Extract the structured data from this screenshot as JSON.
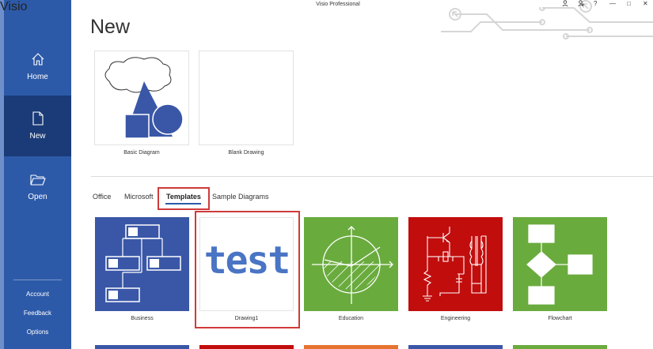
{
  "app": {
    "name": "Visio",
    "window_title": "Visio Professional"
  },
  "nav": {
    "home": "Home",
    "new": "New",
    "open": "Open",
    "account": "Account",
    "feedback": "Feedback",
    "options": "Options"
  },
  "titlebar_icons": {
    "help": "?",
    "minimize": "—",
    "maximize": "□",
    "close": "✕"
  },
  "page": {
    "title": "New"
  },
  "featured": [
    {
      "label": "Basic Diagram",
      "icon": "basic-shapes"
    },
    {
      "label": "Blank Drawing",
      "icon": "blank"
    }
  ],
  "tabs": [
    {
      "label": "Office",
      "active": false
    },
    {
      "label": "Microsoft",
      "active": false
    },
    {
      "label": "Templates",
      "active": true
    },
    {
      "label": "Sample Diagrams",
      "active": false
    }
  ],
  "templates": [
    {
      "label": "Business",
      "color": "#3a57a7"
    },
    {
      "label": "Drawing1",
      "color": "#ffffff",
      "preview_text": "test"
    },
    {
      "label": "Education",
      "color": "#6aab3e"
    },
    {
      "label": "Engineering",
      "color": "#c20d0d"
    },
    {
      "label": "Flowchart",
      "color": "#6aab3e"
    }
  ],
  "colors": {
    "rail": "#2d5aa8",
    "rail_selected": "#1a3b77",
    "highlight": "#d03a3a"
  }
}
